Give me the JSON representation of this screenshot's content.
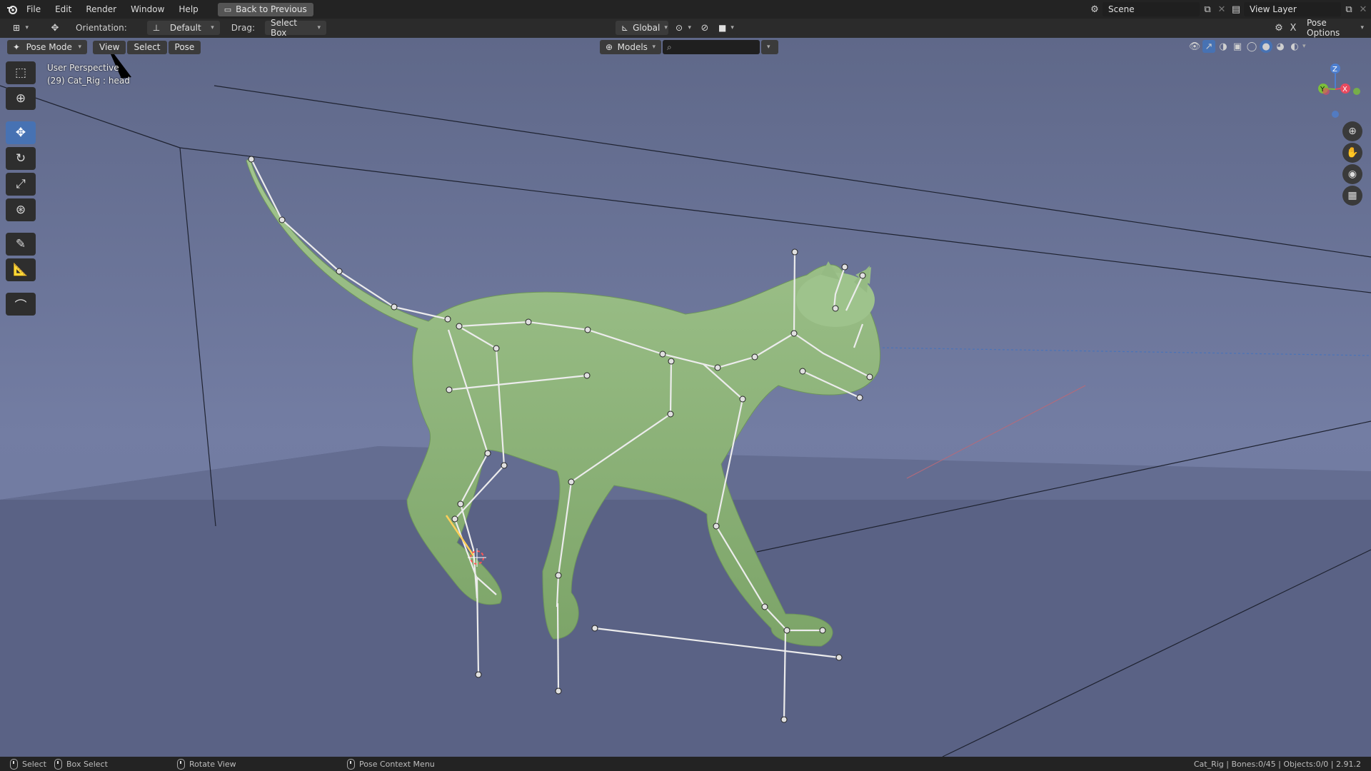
{
  "topbar": {
    "menus": [
      "File",
      "Edit",
      "Render",
      "Window",
      "Help"
    ],
    "back_button": "Back to Previous",
    "scene": "Scene",
    "view_layer": "View Layer"
  },
  "header": {
    "orientation_label": "Orientation:",
    "orientation_value": "Default",
    "drag_label": "Drag:",
    "drag_value": "Select Box",
    "transform_orientation": "Global",
    "pose_options": "Pose Options"
  },
  "viewport_header": {
    "mode": "Pose Mode",
    "menus": [
      "View",
      "Select",
      "Pose"
    ],
    "collection": "Models",
    "search_placeholder": ""
  },
  "viewport": {
    "perspective": "User Perspective",
    "active": "(29) Cat_Rig : head",
    "gizmo": {
      "z": "Z",
      "y": "Y",
      "x": "X"
    },
    "colors": {
      "cat": "#8fb57d",
      "bones": "#e8e8e8",
      "selected_bone": "#ffcf5a",
      "background": "#6a7397"
    }
  },
  "toolbar": {
    "tools": [
      "select-box",
      "cursor",
      "move",
      "rotate",
      "scale",
      "transform",
      "annotate",
      "measure",
      "curve"
    ],
    "active": "move"
  },
  "statusbar": {
    "select": "Select",
    "box_select": "Box Select",
    "rotate_view": "Rotate View",
    "context_menu": "Pose Context Menu",
    "stats": "Cat_Rig | Bones:0/45 | Objects:0/0 | 2.91.2"
  }
}
